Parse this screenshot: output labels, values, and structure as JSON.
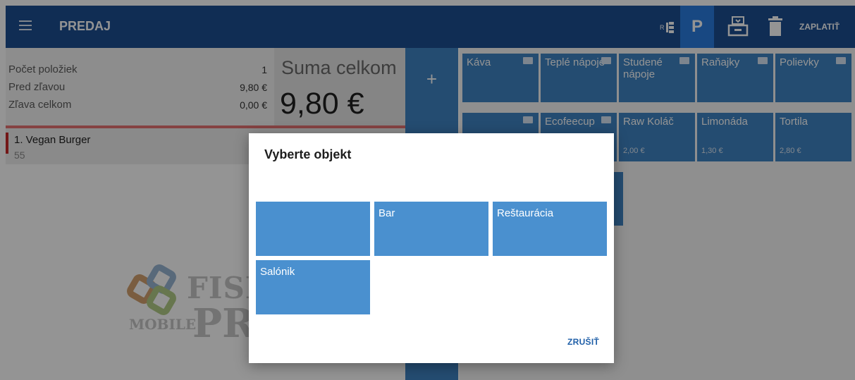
{
  "header": {
    "title": "PREDAJ",
    "menu_icon": "hamburger-menu-icon",
    "p_button": "P",
    "pay_label": "ZAPLATIŤ",
    "accent_color": "#1d4e92",
    "active_color": "#2a7de0"
  },
  "summary": {
    "rows": [
      {
        "label": "Počet položiek",
        "value": "1"
      },
      {
        "label": "Pred zľavou",
        "value": "9,80 €"
      },
      {
        "label": "Zľava celkom",
        "value": "0,00 €"
      }
    ],
    "total_title": "Suma celkom",
    "total_amount": "9,80 €"
  },
  "cart": {
    "items": [
      {
        "name": "1. Vegan Burger",
        "sub": "55"
      }
    ]
  },
  "logo": {
    "line1": "FISK",
    "line2": "PR",
    "line3": "MOBILE"
  },
  "add_button": "+",
  "tiles": [
    {
      "label": "Káva",
      "price": "",
      "folder": true
    },
    {
      "label": "Teplé nápoje",
      "price": "",
      "folder": true
    },
    {
      "label": "Studené nápoje",
      "price": "",
      "folder": true
    },
    {
      "label": "Raňajky",
      "price": "",
      "folder": true
    },
    {
      "label": "Polievky",
      "price": "",
      "folder": true
    },
    {
      "label": "",
      "price": "",
      "folder": true
    },
    {
      "label": "Ecofeecup",
      "price": "",
      "folder": true
    },
    {
      "label": "Raw Koláč",
      "price": "2,00 €",
      "folder": false
    },
    {
      "label": "Limonáda",
      "price": "1,30 €",
      "folder": false
    },
    {
      "label": "Tortila",
      "price": "2,80 €",
      "folder": false
    }
  ],
  "dialog": {
    "title": "Vyberte objekt",
    "objects": [
      "",
      "Bar",
      "Reštaurácia",
      "Salónik"
    ],
    "cancel_label": "ZRUŠIŤ"
  }
}
